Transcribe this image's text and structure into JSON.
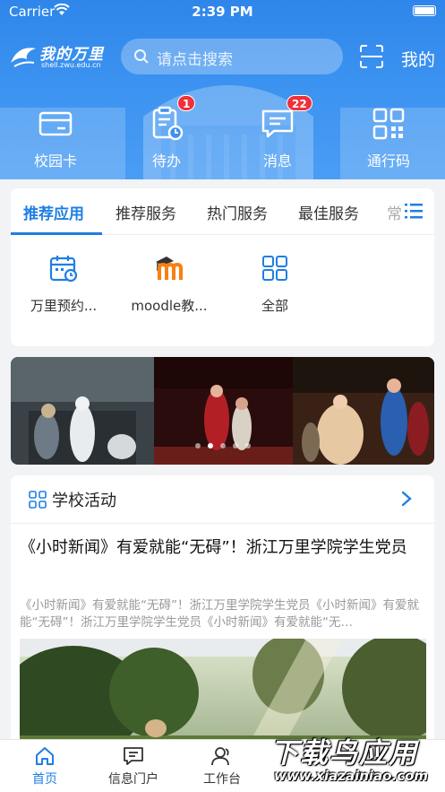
{
  "status_bar": {
    "carrier": "Carrier",
    "time": "2:39 PM"
  },
  "header": {
    "logo_text": "我的万里",
    "logo_subtext": "shell.zwu.edu.cn",
    "search_placeholder": "请点击搜索",
    "mine_label": "我的",
    "accent": "#2f86ea"
  },
  "quick_actions": [
    {
      "label": "校园卡",
      "icon": "card-icon"
    },
    {
      "label": "待办",
      "icon": "todo-clipboard-icon",
      "badge": "1"
    },
    {
      "label": "消息",
      "icon": "message-icon",
      "badge": "22"
    },
    {
      "label": "通行码",
      "icon": "qr-code-icon"
    }
  ],
  "app_tabs": {
    "tabs": [
      "推荐应用",
      "推荐服务",
      "热门服务",
      "最佳服务"
    ],
    "overflow_text": "常",
    "active_index": 0
  },
  "apps": [
    {
      "label": "万里预约...",
      "icon": "calendar-icon"
    },
    {
      "label": "moodle教...",
      "icon": "moodle-icon"
    },
    {
      "label": "全部",
      "icon": "all-grid-icon"
    }
  ],
  "banner": {
    "slide_count": 5,
    "active_slide": 1
  },
  "news": {
    "section_title": "学校活动",
    "headline": "《小时新闻》有爱就能“无碍”！浙江万里学院学生党员",
    "summary": "《小时新闻》有爱就能“无碍”！浙江万里学院学生党员《小时新闻》有爱就能“无碍”！浙江万里学院学生党员《小时新闻》有爱就能“无…"
  },
  "tab_bar": [
    {
      "label": "首页",
      "icon": "home-icon",
      "active": true
    },
    {
      "label": "信息门户",
      "icon": "portal-message-icon",
      "active": false
    },
    {
      "label": "工作台",
      "icon": "workbench-user-icon",
      "active": false
    }
  ],
  "watermark": {
    "title": "下载鸟应用",
    "url": "www.xiazainiao.com"
  }
}
